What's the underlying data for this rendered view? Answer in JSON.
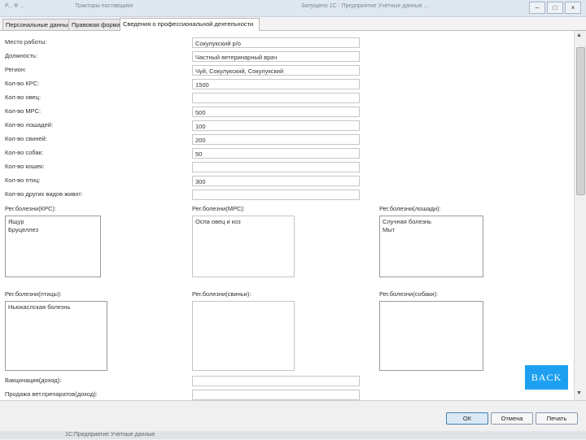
{
  "window": {
    "bg_text_1": "Р...   Ф    ...",
    "bg_text_2": "Тракторы  поставщики",
    "bg_text_3": "Запущено   1С : Предприятие  Учетные  данные ..."
  },
  "tabs": [
    {
      "label": "Персональные данные"
    },
    {
      "label": "Правовая форма"
    },
    {
      "label": "Сведения о профессиональной деятельности"
    }
  ],
  "fields": [
    {
      "label": "Место работы:",
      "value": "Сокулукский р/о"
    },
    {
      "label": "Должность:",
      "value": "Частный ветеринарный врач"
    },
    {
      "label": "Регион:",
      "value": "Чуй, Сокулукский, Сокулукский"
    },
    {
      "label": "Кол-во КРС:",
      "value": "1500"
    },
    {
      "label": "Кол-во овец:",
      "value": ""
    },
    {
      "label": "Кол-во МРС:",
      "value": "500"
    },
    {
      "label": "Кол-во лошадей:",
      "value": "100"
    },
    {
      "label": "Кол-во свиней:",
      "value": "200"
    },
    {
      "label": "Кол-во собак:",
      "value": "50"
    },
    {
      "label": "Кол-во кошек:",
      "value": ""
    },
    {
      "label": "Кол-во птиц:",
      "value": "300"
    },
    {
      "label": "Кол-во других видов живот:",
      "value": ""
    }
  ],
  "diseases": {
    "krs": {
      "label": "Рег.болезни(КРС):",
      "text": "Ящур\nБруцеллез"
    },
    "mrs": {
      "label": "Рег.болезни(МРС):",
      "text": "Оспа овец и коз"
    },
    "horses": {
      "label": "Рег.болезни(лошади):",
      "text": "Случная болезнь\nМыт"
    },
    "birds": {
      "label": "Рег.болезни(птицы):",
      "text": "Ньюкаслская болезнь"
    },
    "pigs": {
      "label": "Рег.болезни(свиньи):",
      "text": ""
    },
    "dogs": {
      "label": "Рег.болезни(собаки):",
      "text": ""
    }
  },
  "extra": {
    "vaccination_label": "Вакцинация(доход):",
    "drug_sales_label": "Продажа вет.препаратов(доход):"
  },
  "back_label": "BACK",
  "buttons": {
    "ok": "ОК",
    "cancel": "Отмена",
    "print": "Печать"
  },
  "taskbar_text": "1С:Предприятие   Учетные данные"
}
